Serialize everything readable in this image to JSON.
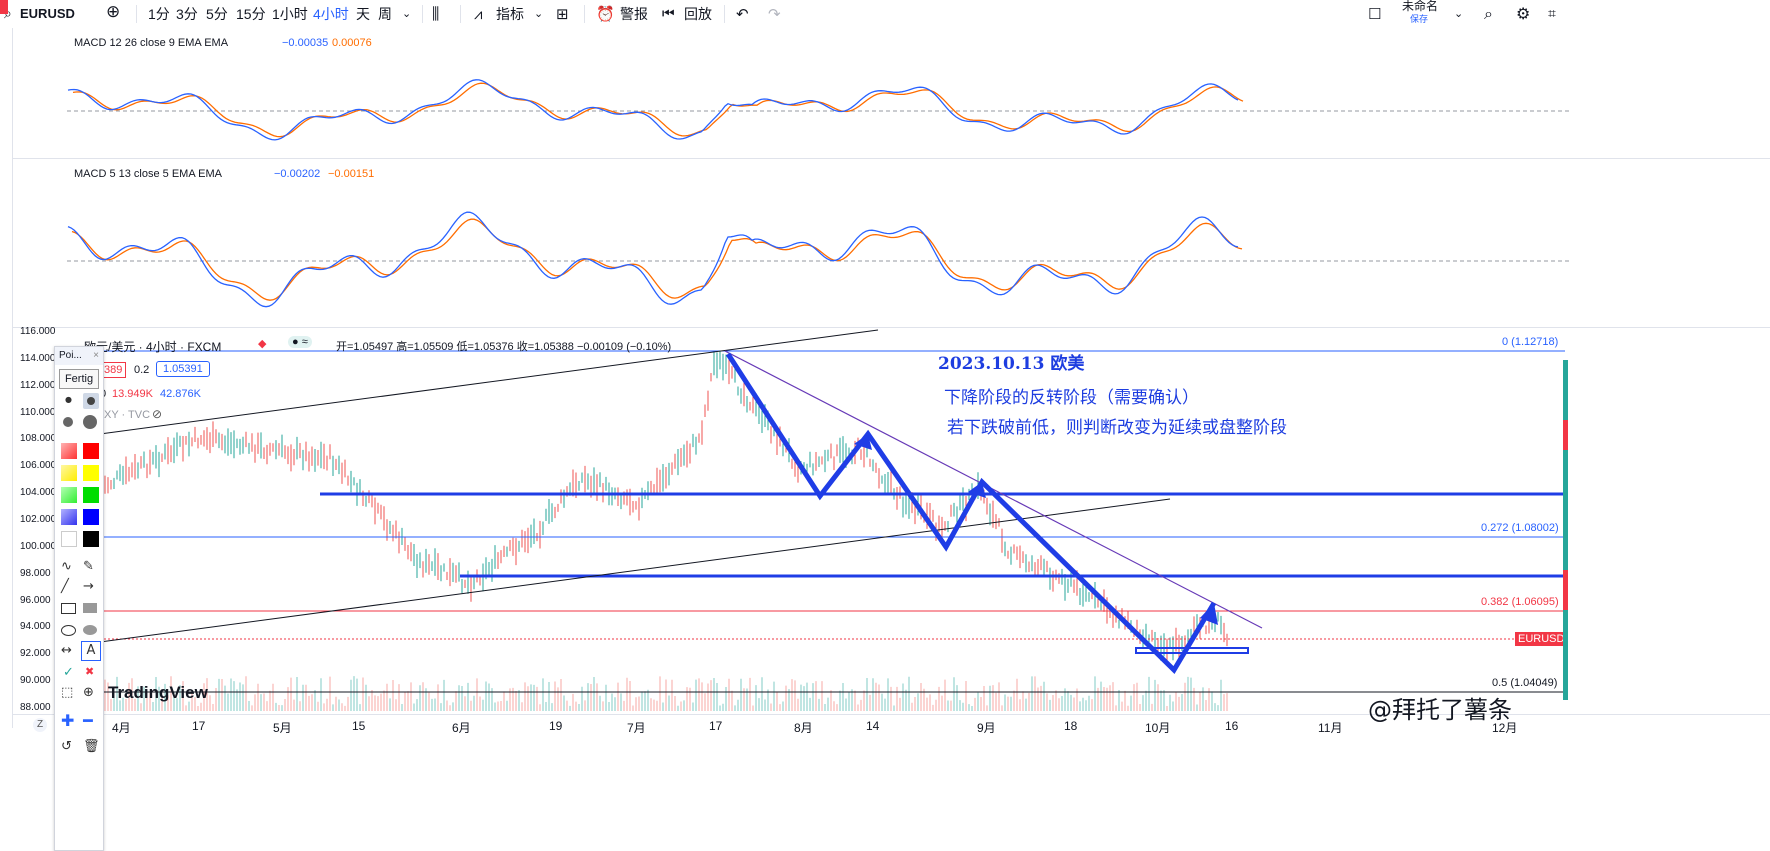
{
  "toolbar": {
    "symbol": "EURUSD",
    "intervals": [
      "1分",
      "3分",
      "5分",
      "15分",
      "1小时",
      "4小时",
      "天",
      "周"
    ],
    "active_interval": "4小时",
    "indicators_label": "指标",
    "alert_label": "警报",
    "replay_label": "回放",
    "layout_name": "未命名",
    "save_label": "保存"
  },
  "macd1": {
    "title": "MACD 12 26 close 9 EMA EMA",
    "value1": "−0.00035",
    "value2": "0.00076"
  },
  "macd2": {
    "title": "MACD 5 13 close 5 EMA EMA",
    "value1": "−0.00202",
    "value2": "−0.00151"
  },
  "main": {
    "title": "欧元/美元 · 4小时 · FXCM",
    "ohlc": "开=1.05497 高=1.05509 低=1.05376 收=1.05388 −0.00109 (−0.10%)",
    "sell_price": "389",
    "spread": "0.2",
    "buy_price": "1.05391",
    "volume_label": "0",
    "volume1": "13.949K",
    "volume2": "42.876K",
    "secondary": "XY · TVC",
    "price_badge": "EURUSD",
    "watermark": "TradingView",
    "credit": "@拜托了薯条"
  },
  "yaxis_ticks": [
    "116.000",
    "114.000",
    "112.000",
    "110.000",
    "108.000",
    "106.000",
    "104.000",
    "102.000",
    "100.000",
    "98.000",
    "96.000",
    "94.000",
    "92.000",
    "90.000",
    "88.000"
  ],
  "xaxis_ticks": [
    "4月",
    "17",
    "5月",
    "15",
    "6月",
    "19",
    "7月",
    "17",
    "8月",
    "14",
    "9月",
    "18",
    "10月",
    "16",
    "11月",
    "12月"
  ],
  "fib": {
    "f0": "0 (1.12718)",
    "f272": "0.272 (1.08002)",
    "f382": "0.382 (1.06095)",
    "f5": "0.5 (1.04049)"
  },
  "annotation": {
    "line1": "2023.10.13 欧美",
    "line2": "下降阶段的反转阶段（需要确认）",
    "line3": "若下跌破前低，则判断改变为延续或盘整阶段"
  },
  "drawbar": {
    "header": "Poi...",
    "fertig": "Fertig",
    "text_tool": "A"
  },
  "colors": {
    "blue_line": "#1f3de6",
    "macd_blue": "#2962ff",
    "macd_orange": "#ff6d00",
    "fib_red": "#f23645",
    "up_candle": "#26a69a",
    "down_candle": "#ef5350"
  }
}
